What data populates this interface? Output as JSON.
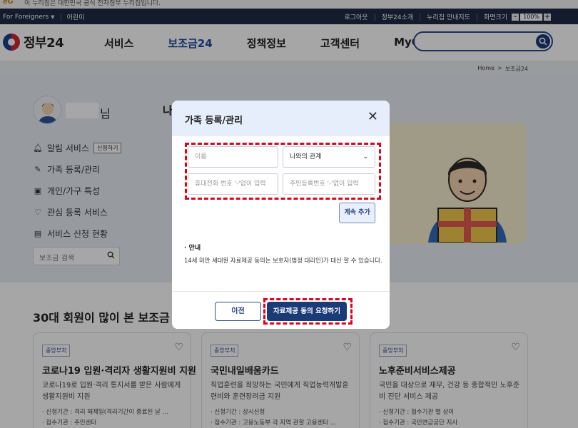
{
  "gov_banner": {
    "logo": "eG",
    "text": "이 누리집은 대한민국 공식 전자정부 누리집입니다."
  },
  "util": {
    "lang": "For Foreigners",
    "kids": "어린이",
    "logout": "로그아웃",
    "about": "정부24소개",
    "guide": "누리집 안내지도",
    "zoom_label": "화면크기",
    "zoom_minus": "-",
    "zoom_value": "100%",
    "zoom_plus": "+"
  },
  "header": {
    "brand": "정부24",
    "nav": [
      "서비스",
      "보조금24",
      "정책정보",
      "고객센터",
      "MyGOV"
    ],
    "active_index": 1,
    "search_icon": "search-icon"
  },
  "breadcrumb": {
    "home": "Home",
    "separator": ">",
    "current": "보조금24"
  },
  "sidebar": {
    "name_suffix": "님",
    "menu": [
      {
        "label": "알림 서비스",
        "icon": "bell-icon",
        "badge": "신청하기"
      },
      {
        "label": "가족 등록/관리",
        "icon": "pencil-icon"
      },
      {
        "label": "개인/가구 특성",
        "icon": "id-card-icon"
      },
      {
        "label": "관심 등록 서비스",
        "icon": "heart-icon"
      },
      {
        "label": "서비스 신청 현황",
        "icon": "clipboard-icon"
      }
    ],
    "search_placeholder": "보조금 검색"
  },
  "hero": {
    "title": "나"
  },
  "section": {
    "title": "30대 회원이 많이 본 보조금",
    "cards": [
      {
        "tag": "중앙부처",
        "title": "코로나19 입원·격리자 생활지원비 지원",
        "desc": "코로나19로 입원·격리 통지서를 받은 사람에게 생활지원비 지원",
        "meta1": "· 신청기간 : 격리 해제일(격리기간이 종료된 날 ...",
        "meta2": "· 접수기관 : 주민센터"
      },
      {
        "tag": "중앙부처",
        "title": "국민내일배움카드",
        "desc": "직업훈련을 희망하는 국민에게 직업능력개발훈련비와 훈련장려금 지원",
        "meta1": "· 신청기간 : 상시신청",
        "meta2": "· 접수기관 : 고용노동부 각 지역 관할 고용센터 ..."
      },
      {
        "tag": "중앙부처",
        "title": "노후준비서비스제공",
        "desc": "국민을 대상으로 재무, 건강 등 종합적인 노후준비 진단 서비스 제공",
        "meta1": "· 신청기간 : 접수기관 별 상이",
        "meta2": "· 접수기관 : 국민연금공단 지사"
      }
    ]
  },
  "modal": {
    "title": "가족 등록/관리",
    "name_placeholder": "이름",
    "relation_value": "나와의 관계",
    "phone_placeholder": "휴대전화 번호 '-'없이 입력",
    "rrn_placeholder": "주민등록번호 '-'없이 입력",
    "add_more": "계속 추가",
    "notice_heading": "· 안내",
    "notice_text": "14세 미만 세대원 자료제공 동의는 보호자(법정 대리인)가 대신 할 수 있습니다.",
    "prev": "이전",
    "submit": "자료제공 동의 요청하기",
    "highlight_color": "#e3001b"
  }
}
